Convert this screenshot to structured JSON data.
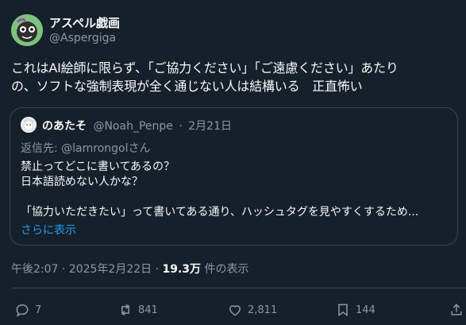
{
  "author": {
    "name": "アスペル戯画",
    "handle": "@Aspergiga"
  },
  "tweet": {
    "lines": [
      "これはAI絵師に限らず、「ご協力ください」「ご遠慮ください」あたり",
      "の、ソフトな強制表現が全く通じない人は結構いる　正直怖い"
    ]
  },
  "quote": {
    "name": "のあたそ",
    "handle": "@Noah_Penpe",
    "separator": "·",
    "date": "2月21日",
    "reply_to": "返信先: @lamrongolさん",
    "lines": [
      "禁止ってどこに書いてあるの？",
      "日本語読めない人かな？",
      "",
      "「協力いただきたい」って書いてある通り、ハッシュタグを見やすくするため..."
    ],
    "show_more": "さらに表示"
  },
  "meta": {
    "time": "午後2:07 · 2025年2月22日 · ",
    "views": "19.3万",
    "views_suffix": " 件の表示"
  },
  "actions": {
    "reply_count": "7",
    "repost_count": "841",
    "like_count": "2,811",
    "bookmark_count": "144"
  },
  "icons": [
    "reply-icon",
    "repost-icon",
    "like-icon",
    "bookmark-icon",
    "share-icon"
  ],
  "colors": {
    "background": "#15202b",
    "secondary_text": "#8b98a5",
    "link": "#1d9bf0",
    "border": "#38444d"
  }
}
